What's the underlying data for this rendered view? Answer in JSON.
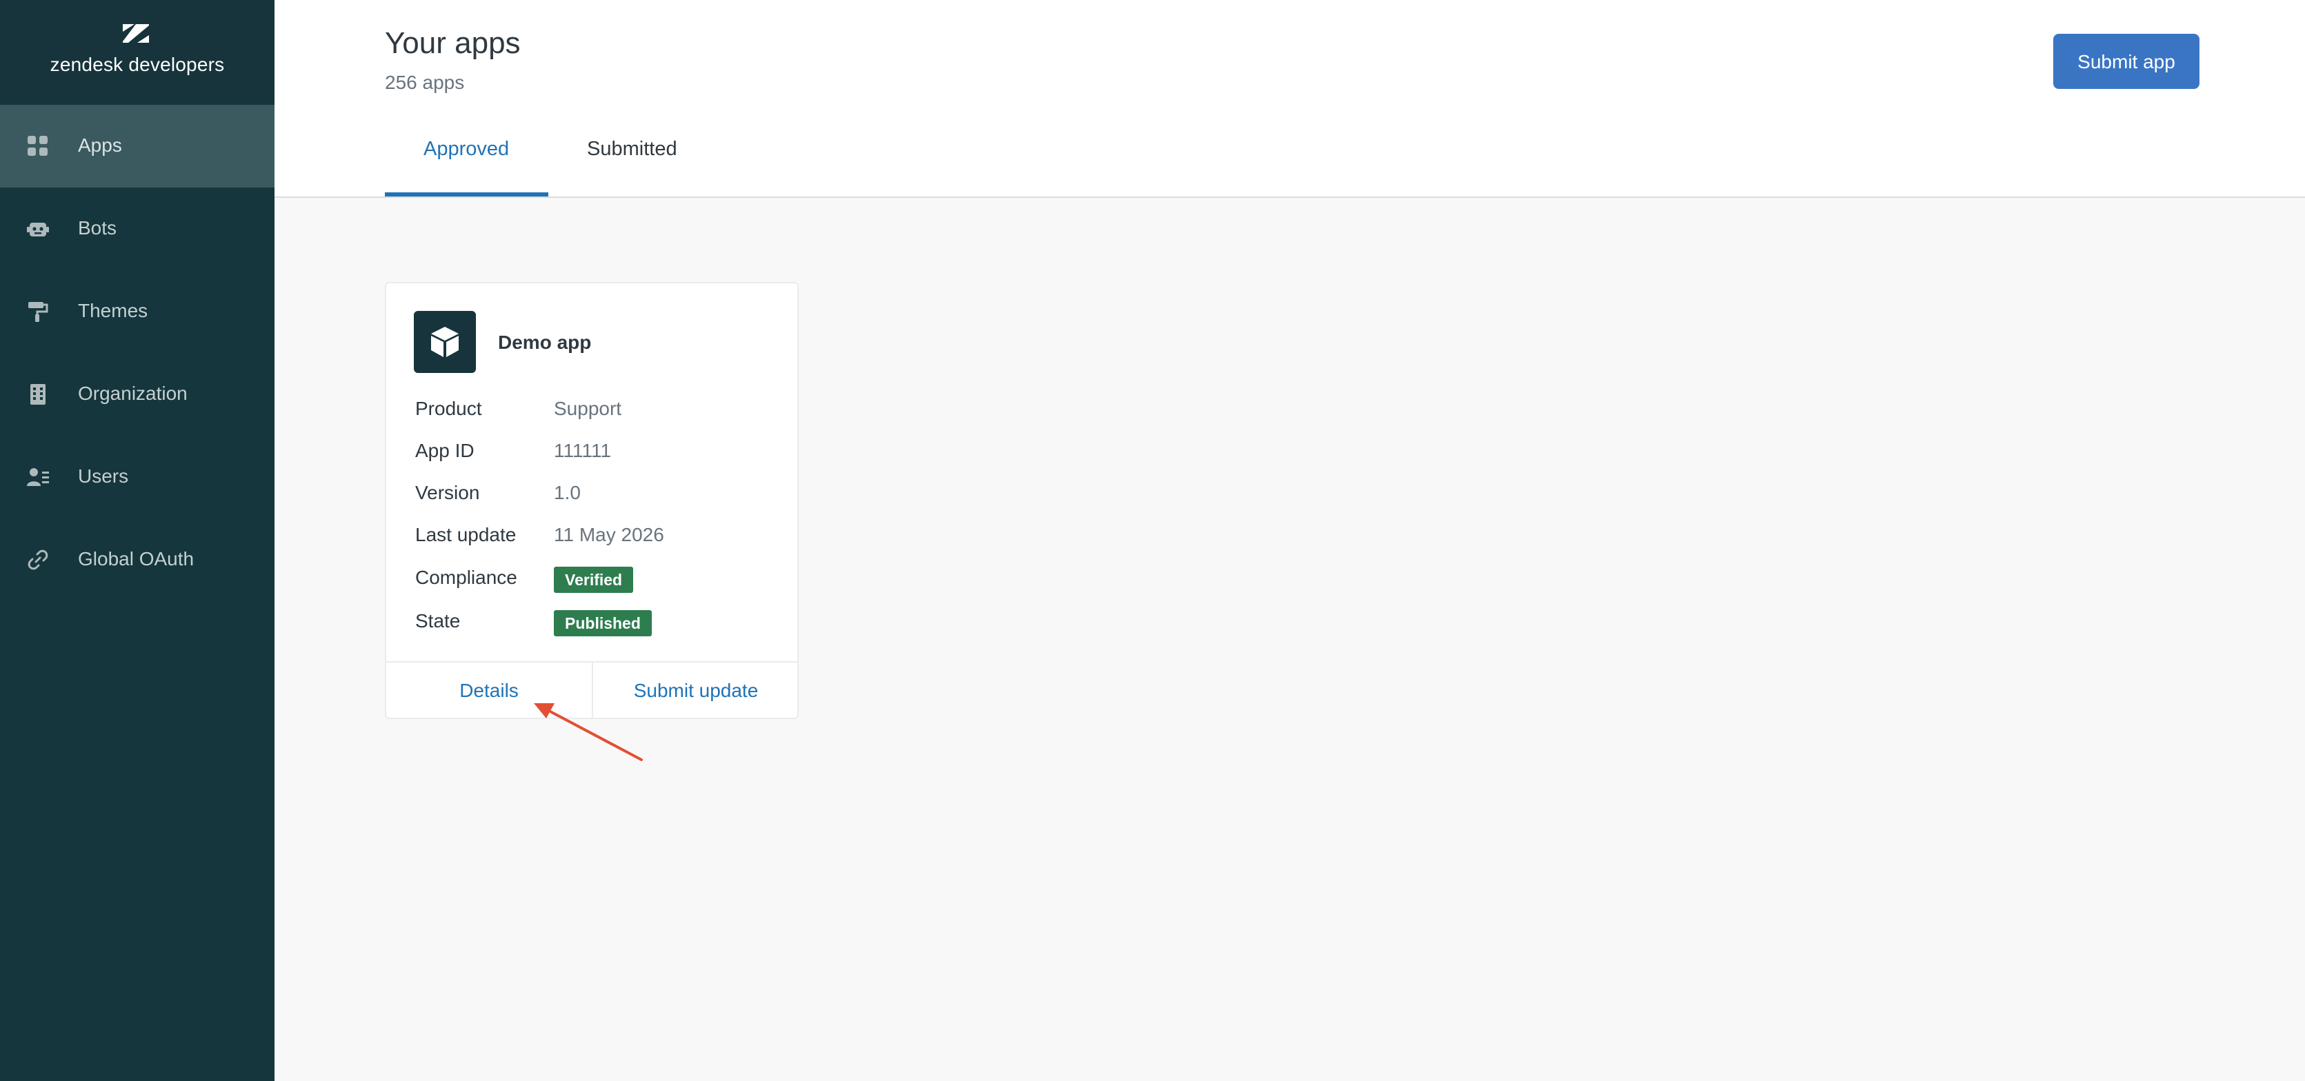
{
  "sidebar": {
    "brand": "zendesk developers",
    "items": [
      {
        "label": "Apps",
        "icon": "apps-grid-icon",
        "active": true
      },
      {
        "label": "Bots",
        "icon": "bot-icon",
        "active": false
      },
      {
        "label": "Themes",
        "icon": "paint-roller-icon",
        "active": false
      },
      {
        "label": "Organization",
        "icon": "building-icon",
        "active": false
      },
      {
        "label": "Users",
        "icon": "users-icon",
        "active": false
      },
      {
        "label": "Global OAuth",
        "icon": "link-icon",
        "active": false
      }
    ]
  },
  "header": {
    "title": "Your apps",
    "count": "256 apps",
    "submit_label": "Submit app",
    "tabs": [
      {
        "label": "Approved",
        "active": true
      },
      {
        "label": "Submitted",
        "active": false
      }
    ]
  },
  "card": {
    "name": "Demo app",
    "icon": "cube-icon",
    "fields": [
      {
        "label": "Product",
        "value": "Support"
      },
      {
        "label": "App ID",
        "value": "111111"
      },
      {
        "label": "Version",
        "value": "1.0"
      },
      {
        "label": "Last update",
        "value": "11 May 2026"
      },
      {
        "label": "Compliance",
        "value": "Verified"
      },
      {
        "label": "State",
        "value": "Published"
      }
    ],
    "details_label": "Details",
    "submit_update_label": "Submit update"
  },
  "colors": {
    "sidebar_bg": "#15363d",
    "sidebar_active": "#3b5a60",
    "primary_blue": "#3a75c4",
    "link_blue": "#1f73b7",
    "badge_green": "#2e7d4f",
    "arrow_red": "#e34f32"
  }
}
